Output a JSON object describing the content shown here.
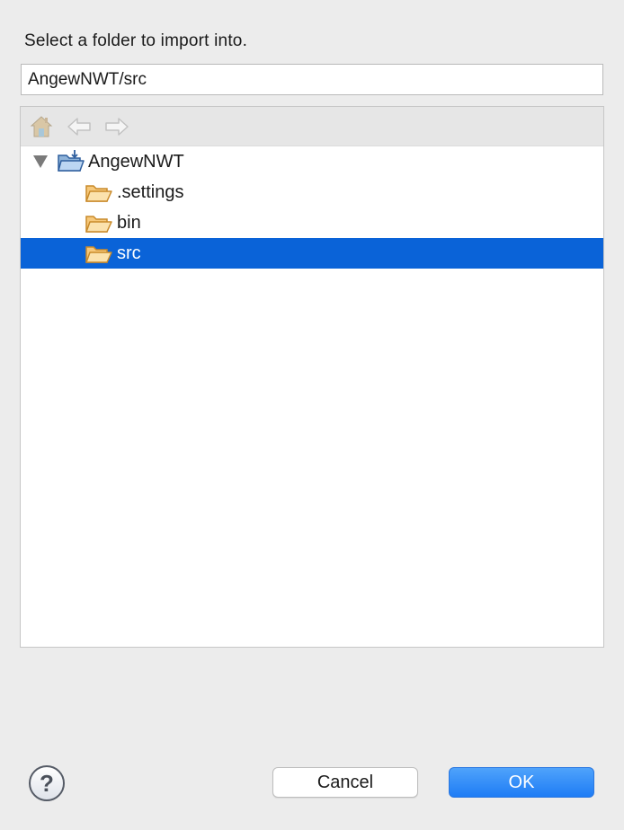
{
  "dialog": {
    "prompt": "Select a folder to import into."
  },
  "path_input": {
    "value": "AngewNWT/src"
  },
  "toolbar": {
    "icons": [
      "home-icon",
      "back-arrow-icon",
      "forward-arrow-icon"
    ]
  },
  "tree": {
    "root": {
      "label": "AngewNWT",
      "expanded": true,
      "icon": "project-folder-icon"
    },
    "children": [
      {
        "label": ".settings",
        "icon": "folder-open-icon",
        "selected": false
      },
      {
        "label": "bin",
        "icon": "folder-open-icon",
        "selected": false
      },
      {
        "label": "src",
        "icon": "folder-open-icon",
        "selected": true
      }
    ]
  },
  "buttons": {
    "help_symbol": "?",
    "cancel_label": "Cancel",
    "ok_label": "OK"
  },
  "colors": {
    "selection": "#0a63d8",
    "ok_button": "#1e7cf5",
    "folder": "#f2b04a"
  }
}
